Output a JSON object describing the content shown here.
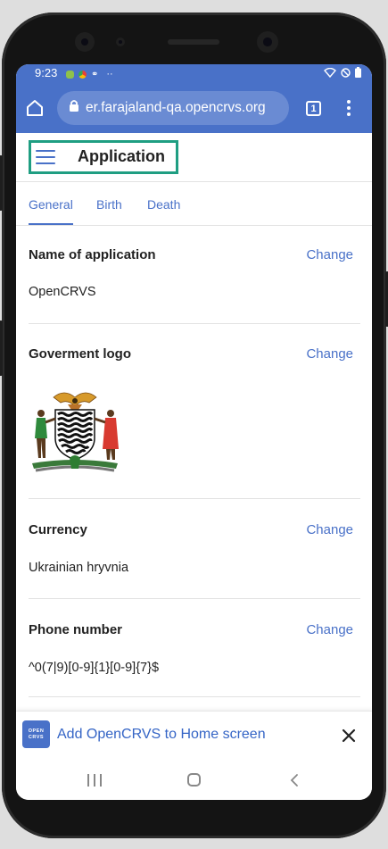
{
  "status_bar": {
    "time": "9:23",
    "extra": "··"
  },
  "browser": {
    "url": "er.farajaland-qa.opencrvs.org",
    "tab_count": "1"
  },
  "app": {
    "title": "Application"
  },
  "tabs": [
    {
      "label": "General",
      "active": true
    },
    {
      "label": "Birth",
      "active": false
    },
    {
      "label": "Death",
      "active": false
    }
  ],
  "sections": {
    "name": {
      "label": "Name of application",
      "change": "Change",
      "value": "OpenCRVS"
    },
    "logo": {
      "label": "Goverment logo",
      "change": "Change"
    },
    "currency": {
      "label": "Currency",
      "change": "Change",
      "value": "Ukrainian hryvnia"
    },
    "phone": {
      "label": "Phone number",
      "change": "Change",
      "value": "^0(7|9)[0-9]{1}[0-9]{7}$"
    }
  },
  "install_banner": {
    "icon_line1": "OPEN",
    "icon_line2": "CRVS",
    "text": "Add OpenCRVS to Home screen"
  },
  "colors": {
    "primary": "#4971c8",
    "highlight": "#1f9e82",
    "text": "#222222"
  },
  "icons": {
    "home": "home-icon",
    "lock": "lock-icon",
    "menu": "more-vert-icon",
    "hamburger": "hamburger-menu-icon",
    "close": "close-icon"
  }
}
